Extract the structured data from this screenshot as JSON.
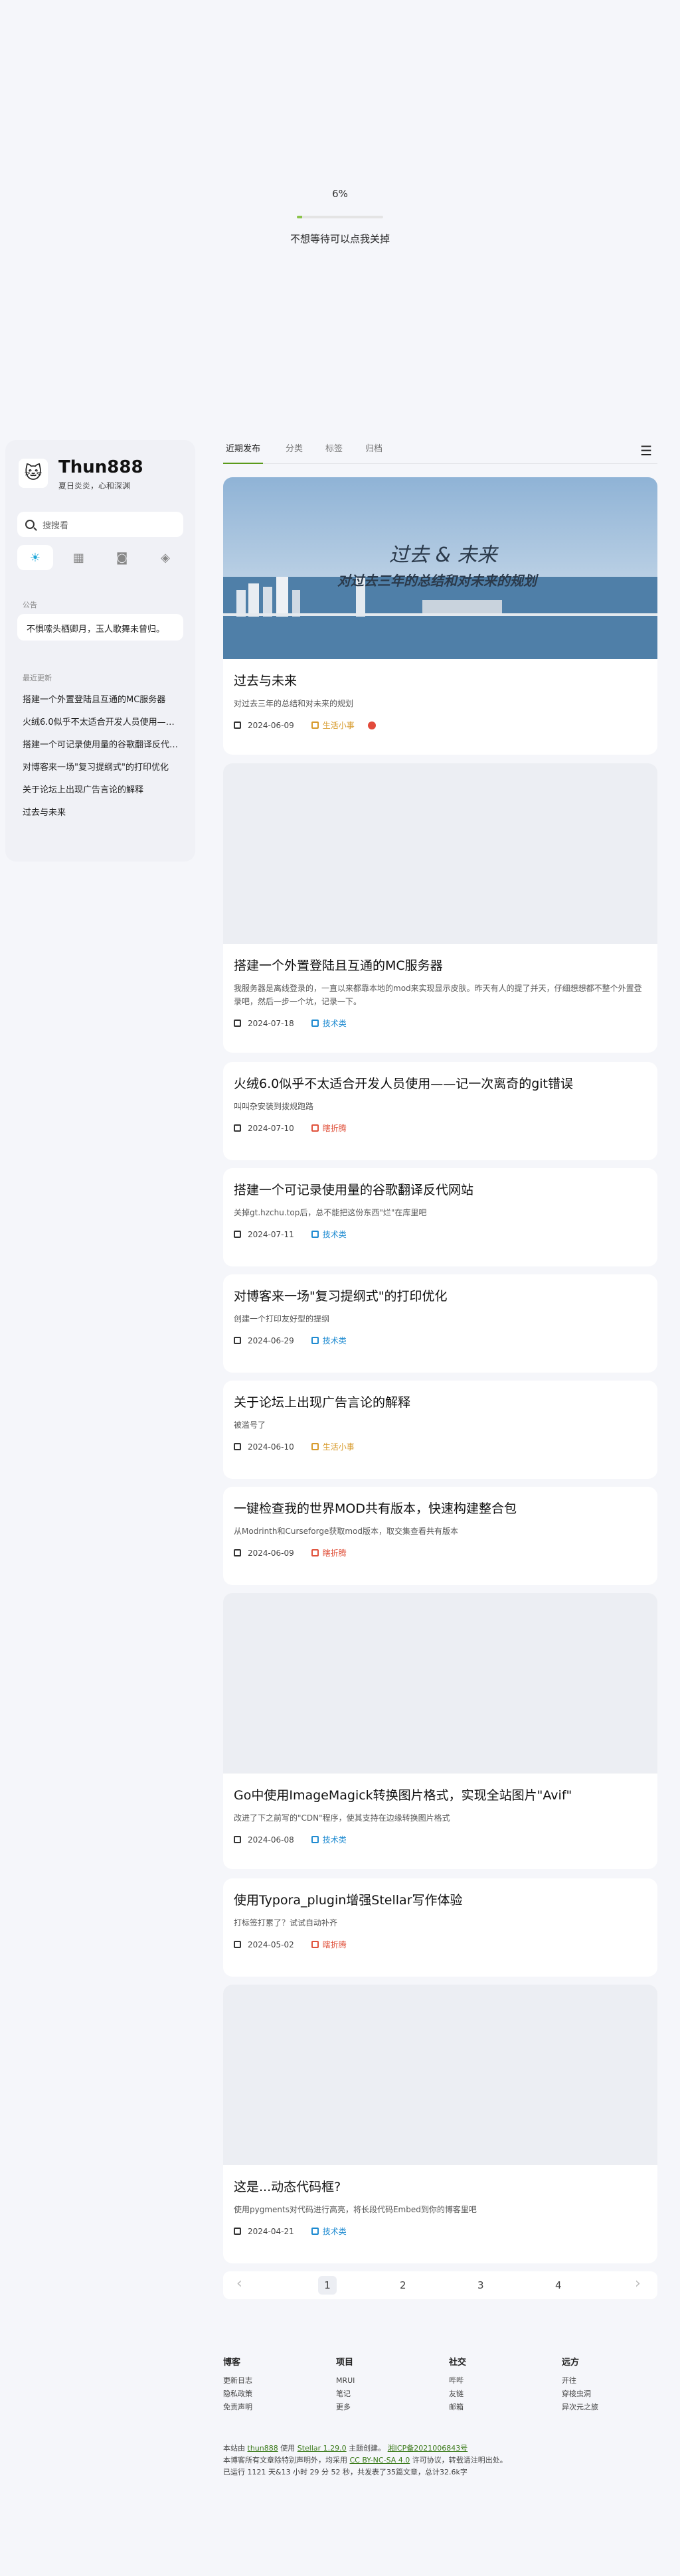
{
  "loader": {
    "percent": "6%",
    "progress": 0.06,
    "hint": "不想等待可以点我关掉"
  },
  "sidebar": {
    "title": "Thun888",
    "subtitle": "夏日炎炎，心和深渊",
    "search_placeholder": "搜搜看",
    "quick_icons": [
      "sun-icon",
      "grid-icon",
      "chat-icon",
      "tag-icon"
    ],
    "announce_label": "公告",
    "announce_text": "不惧嗦头栖卿月，玉人歌舞未曾归。",
    "recent_label": "最近更新",
    "recent": [
      "搭建一个外置登陆且互通的MC服务器",
      "火绒6.0似乎不太适合开发人员使用——记一次离奇的git错误",
      "搭建一个可记录使用量的谷歌翻译反代网站",
      "对博客来一场\"复习提纲式\"的打印优化",
      "关于论坛上出现广告言论的解释",
      "过去与未来"
    ]
  },
  "tabs": {
    "items": [
      "近期发布",
      "分类",
      "标签",
      "归档"
    ],
    "active": 0
  },
  "posts": [
    {
      "title": "过去与未来",
      "excerpt": "对过去三年的总结和对未来的规划",
      "date": "2024-06-09",
      "category": "生活小事",
      "cat_color": "#d79a2b",
      "pinned": true,
      "cover_title": "过去 & 未来",
      "cover_sub": "对过去三年的总结和对未来的规划"
    },
    {
      "title": "搭建一个外置登陆且互通的MC服务器",
      "excerpt": "我服务器是离线登录的，一直以来都靠本地的mod来实现显示皮肤。昨天有人的提了并天，仔细想想都不整个外置登录吧，然后一步一个坑，记录一下。",
      "date": "2024-07-18",
      "category": "技术类",
      "cat_color": "#1f8bd1"
    },
    {
      "title": "火绒6.0似乎不太适合开发人员使用——记一次离奇的git错误",
      "excerpt": "叫叫杂安装到拨规跑路",
      "date": "2024-07-10",
      "category": "瞎折腾",
      "cat_color": "#e0523c"
    },
    {
      "title": "搭建一个可记录使用量的谷歌翻译反代网站",
      "excerpt": "关掉gt.hzchu.top后，总不能把这份东西\"烂\"在库里吧",
      "date": "2024-07-11",
      "category": "技术类",
      "cat_color": "#1f8bd1"
    },
    {
      "title": "对博客来一场\"复习提纲式\"的打印优化",
      "excerpt": "创建一个打印友好型的提纲",
      "date": "2024-06-29",
      "category": "技术类",
      "cat_color": "#1f8bd1"
    },
    {
      "title": "关于论坛上出现广告言论的解释",
      "excerpt": "被滥号了",
      "date": "2024-06-10",
      "category": "生活小事",
      "cat_color": "#d79a2b"
    },
    {
      "title": "一键检查我的世界MOD共有版本，快速构建整合包",
      "excerpt": "从Modrinth和Curseforge获取mod版本，取交集查看共有版本",
      "date": "2024-06-09",
      "category": "瞎折腾",
      "cat_color": "#e0523c"
    },
    {
      "title": "Go中使用ImageMagick转换图片格式，实现全站图片\"Avif\"",
      "excerpt": "改进了下之前写的\"CDN\"程序，使其支持在边缘转换图片格式",
      "date": "2024-06-08",
      "category": "技术类",
      "cat_color": "#1f8bd1"
    },
    {
      "title": "使用Typora_plugin增强Stellar写作体验",
      "excerpt": "打标签打累了？试试自动补齐",
      "date": "2024-05-02",
      "category": "瞎折腾",
      "cat_color": "#e0523c"
    },
    {
      "title": "这是...动态代码框?",
      "excerpt": "使用pygments对代码进行高亮，将长段代码Embed到你的博客里吧",
      "date": "2024-04-21",
      "category": "技术类",
      "cat_color": "#1f8bd1"
    }
  ],
  "pager": {
    "pages": [
      "1",
      "2",
      "3",
      "4"
    ],
    "current": "1"
  },
  "footer": {
    "cols": [
      {
        "head": "博客",
        "links": [
          "更新日志",
          "隐私政策",
          "免责声明"
        ]
      },
      {
        "head": "项目",
        "links": [
          "MRUI",
          "笔记",
          "更多"
        ]
      },
      {
        "head": "社交",
        "links": [
          "哔哔",
          "友链",
          "邮箱"
        ]
      },
      {
        "head": "远方",
        "links": [
          "开往",
          "穿梭虫洞",
          "异次元之旅"
        ]
      }
    ],
    "line1_a": "本站由",
    "line1_b": "thun888",
    "line1_c": "使用",
    "line1_d": "Stellar 1.29.0",
    "line1_e": "主题创建。",
    "line1_f": "湘ICP备2021006843号",
    "line2_a": "本博客所有文章除特别声明外，均采用",
    "line2_b": "CC BY-NC-SA 4.0",
    "line2_c": "许可协议，转载请注明出处。",
    "line3": "已运行 1121 天&13 小时 29 分 52 秒，共发表了35篇文章，总计32.6k字"
  }
}
